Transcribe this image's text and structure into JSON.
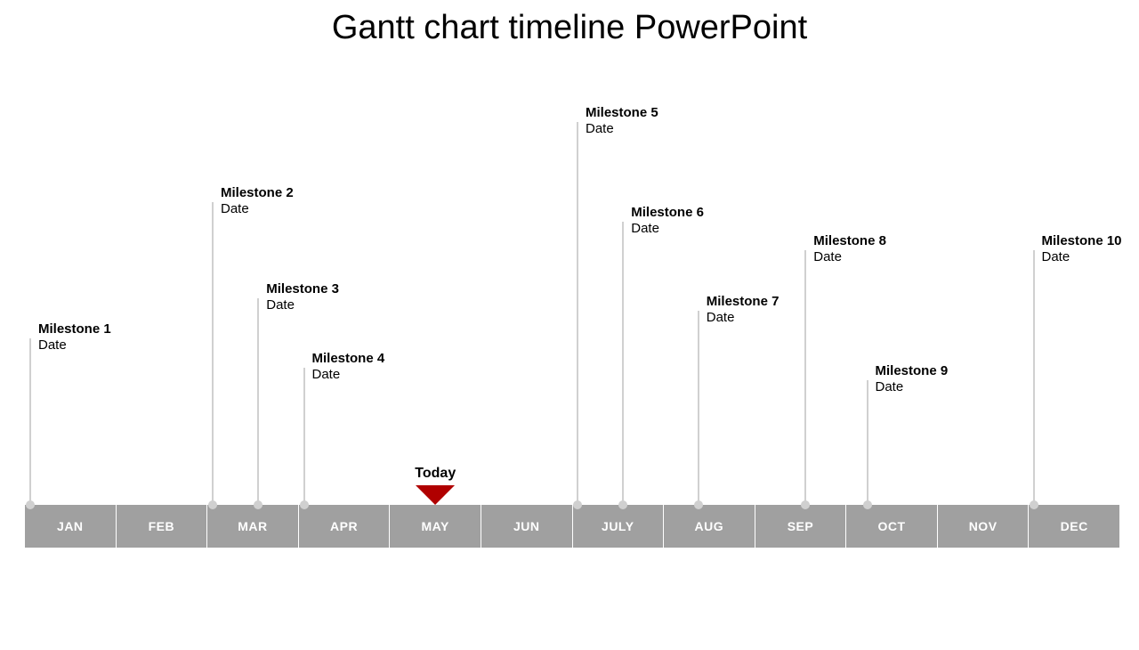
{
  "title": "Gantt chart timeline PowerPoint",
  "today_label": "Today",
  "today_column": 4,
  "months": [
    "JAN",
    "FEB",
    "MAR",
    "APR",
    "MAY",
    "JUN",
    "JULY",
    "AUG",
    "SEP",
    "OCT",
    "NOV",
    "DEC"
  ],
  "milestones": [
    {
      "name": "Milestone 1",
      "date": "Date",
      "columnStart": 0,
      "stem_h": 187
    },
    {
      "name": "Milestone 2",
      "date": "Date",
      "columnStart": 2,
      "stem_h": 340
    },
    {
      "name": "Milestone 3",
      "date": "Date",
      "columnMid": 2,
      "stem_h": 232
    },
    {
      "name": "Milestone 4",
      "date": "Date",
      "columnStart": 3,
      "stem_h": 154
    },
    {
      "name": "Milestone 5",
      "date": "Date",
      "columnStart": 6,
      "stem_h": 430
    },
    {
      "name": "Milestone 6",
      "date": "Date",
      "columnMid": 6,
      "stem_h": 318
    },
    {
      "name": "Milestone 7",
      "date": "Date",
      "columnMid": 7,
      "xNudge": -18,
      "stem_h": 218
    },
    {
      "name": "Milestone 8",
      "date": "Date",
      "columnMid": 8,
      "stem_h": 286
    },
    {
      "name": "Milestone 9",
      "date": "Date",
      "columnStart": 9,
      "xNudge": 18,
      "stem_h": 140
    },
    {
      "name": "Milestone 10",
      "date": "Date",
      "columnStart": 11,
      "stem_h": 286
    }
  ],
  "chart_data": {
    "type": "gantt-timeline",
    "title": "Gantt chart timeline PowerPoint",
    "axis_categories": [
      "JAN",
      "FEB",
      "MAR",
      "APR",
      "MAY",
      "JUN",
      "JULY",
      "AUG",
      "SEP",
      "OCT",
      "NOV",
      "DEC"
    ],
    "today_marker": {
      "label": "Today",
      "position_category_index": 4
    },
    "series": [
      {
        "name": "Milestone 1",
        "date_label": "Date"
      },
      {
        "name": "Milestone 2",
        "date_label": "Date"
      },
      {
        "name": "Milestone 3",
        "date_label": "Date"
      },
      {
        "name": "Milestone 4",
        "date_label": "Date"
      },
      {
        "name": "Milestone 5",
        "date_label": "Date"
      },
      {
        "name": "Milestone 6",
        "date_label": "Date"
      },
      {
        "name": "Milestone 7",
        "date_label": "Date"
      },
      {
        "name": "Milestone 8",
        "date_label": "Date"
      },
      {
        "name": "Milestone 9",
        "date_label": "Date"
      },
      {
        "name": "Milestone 10",
        "date_label": "Date"
      }
    ]
  }
}
